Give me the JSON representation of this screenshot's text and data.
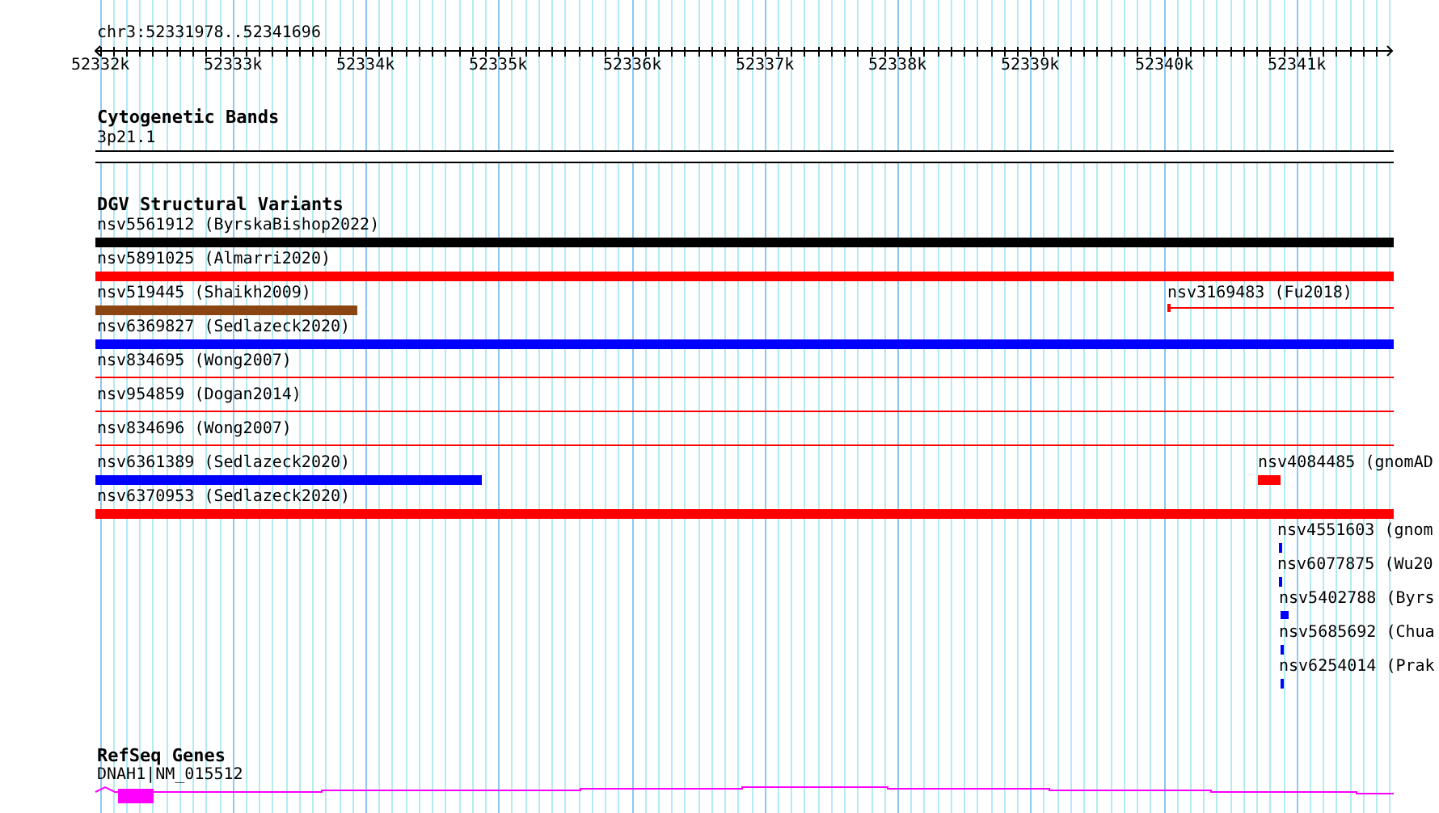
{
  "ruler": {
    "range": "chr3:52331978..52341696",
    "ticks": [
      "52332k",
      "52333k",
      "52334k",
      "52335k",
      "52336k",
      "52337k",
      "52338k",
      "52339k",
      "52340k",
      "52341k"
    ]
  },
  "tracks": [
    {
      "kind": "bands",
      "title": "Cytogenetic Bands",
      "features": [
        {
          "label": "3p21.1",
          "color": "#ffffff"
        }
      ]
    },
    {
      "kind": "variants",
      "title": "DGV Structural Variants",
      "features": [
        {
          "label": "nsv5561912 (ByrskaBishop2022)",
          "kind": "bar",
          "color": "#000000"
        },
        {
          "label": "nsv5891025 (Almarri2020)",
          "kind": "bar",
          "color": "#ff0000"
        },
        {
          "label": "nsv519445 (Shaikh2009)",
          "kind": "bar",
          "color": "#8b4513"
        },
        {
          "label": "nsv3169483 (Fu2018)",
          "kind": "line",
          "color": "#ff0000"
        },
        {
          "label": "nsv6369827 (Sedlazeck2020)",
          "kind": "bar",
          "color": "#0000ff"
        },
        {
          "label": "nsv834695 (Wong2007)",
          "kind": "line",
          "color": "#ff0000"
        },
        {
          "label": "nsv954859 (Dogan2014)",
          "kind": "line",
          "color": "#ff0000"
        },
        {
          "label": "nsv834696 (Wong2007)",
          "kind": "line",
          "color": "#ff0000"
        },
        {
          "label": "nsv6361389 (Sedlazeck2020)",
          "kind": "bar",
          "color": "#0000ff"
        },
        {
          "label": "nsv4084485 (gnomAD",
          "kind": "bar",
          "color": "#ff0000"
        },
        {
          "label": "nsv6370953 (Sedlazeck2020)",
          "kind": "bar",
          "color": "#ff0000"
        },
        {
          "label": "nsv4551603 (gnom",
          "kind": "bar",
          "color": "#0000ff"
        },
        {
          "label": "nsv6077875 (Wu20",
          "kind": "bar",
          "color": "#0000ff"
        },
        {
          "label": "nsv5402788 (Byrs",
          "kind": "bar",
          "color": "#0000ff"
        },
        {
          "label": "nsv5685692 (Chua",
          "kind": "bar",
          "color": "#0000ff"
        },
        {
          "label": "nsv6254014 (Prak",
          "kind": "bar",
          "color": "#0000ff"
        }
      ]
    },
    {
      "kind": "genes",
      "title": "RefSeq Genes",
      "features": [
        {
          "label": "DNAH1|NM_015512",
          "color": "#ff00ff"
        }
      ]
    }
  ]
}
